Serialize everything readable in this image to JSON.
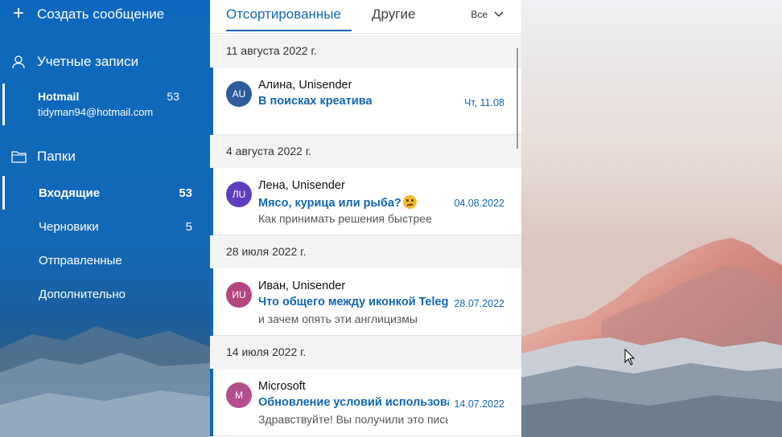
{
  "sidebar": {
    "compose_label": "Создать сообщение",
    "accounts_label": "Учетные записи",
    "account": {
      "name": "Hotmail",
      "email": "tidyman94@hotmail.com",
      "count": "53"
    },
    "folders_label": "Папки",
    "folders": [
      {
        "label": "Входящие",
        "count": "53",
        "active": true
      },
      {
        "label": "Черновики",
        "count": "5",
        "active": false
      },
      {
        "label": "Отправленные",
        "count": "",
        "active": false
      },
      {
        "label": "Дополнительно",
        "count": "",
        "active": false
      }
    ]
  },
  "list": {
    "tabs": [
      {
        "label": "Отсортированные",
        "active": true
      },
      {
        "label": "Другие",
        "active": false
      }
    ],
    "filter_label": "Все",
    "groups": [
      {
        "date_header": "11 августа 2022 г.",
        "message": {
          "initials": "AU",
          "avatar_color": "#2f5b9c",
          "sender": "Алина, Unisender",
          "subject": "В поисках креатива",
          "preview": "",
          "date": "Чт, 11.08"
        }
      },
      {
        "date_header": "4 августа 2022 г.",
        "message": {
          "initials": "ЛU",
          "avatar_color": "#5f3dbf",
          "sender": "Лена, Unisender",
          "subject": "Мясо, курица или рыба?",
          "preview": "Как принимать решения быстрее",
          "date": "04.08.2022"
        }
      },
      {
        "date_header": "28 июля 2022 г.",
        "message": {
          "initials": "ИU",
          "avatar_color": "#b3457f",
          "sender": "Иван, Unisender",
          "subject": "Что общего между иконкой Telegram",
          "preview": "и зачем опять эти англицизмы",
          "date": "28.07.2022"
        }
      },
      {
        "date_header": "14 июля 2022 г.",
        "message": {
          "initials": "M",
          "avatar_color": "#b34f8e",
          "sender": "Microsoft",
          "subject": "Обновление условий использования",
          "preview": "Здравствуйте! Вы получили это письмо",
          "date": "14.07.2022"
        }
      }
    ]
  },
  "colors": {
    "accent": "#1366b5",
    "sidebar": "#0d68bd"
  },
  "icons": {
    "compose": "plus-icon",
    "accounts": "person-icon",
    "folders": "folder-icon",
    "filter": "chevron-down-icon",
    "emoji": "thinking-face-emoji"
  }
}
